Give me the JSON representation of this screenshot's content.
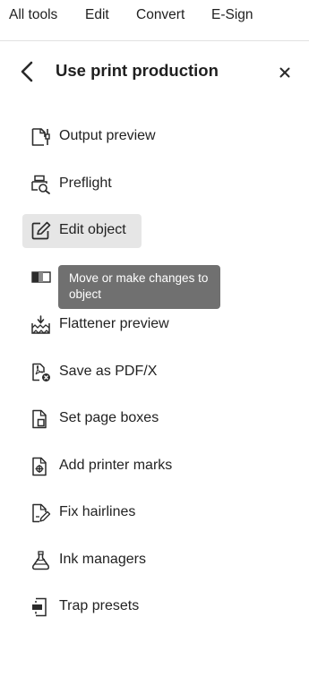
{
  "nav": {
    "items": [
      {
        "label": "All tools"
      },
      {
        "label": "Edit"
      },
      {
        "label": "Convert"
      },
      {
        "label": "E-Sign"
      }
    ]
  },
  "panel": {
    "title": "Use print production",
    "back_icon": "chevron-left-icon",
    "close_icon": "close-icon"
  },
  "tools": [
    {
      "label": "Output preview",
      "icon": "output-preview-icon"
    },
    {
      "label": "Preflight",
      "icon": "preflight-icon"
    },
    {
      "label": "Edit object",
      "icon": "edit-object-icon",
      "selected": true
    },
    {
      "label": "",
      "icon": "transparency-icon"
    },
    {
      "label": "Flattener preview",
      "icon": "flattener-preview-icon"
    },
    {
      "label": "Save as PDF/X",
      "icon": "save-pdfx-icon"
    },
    {
      "label": "Set page boxes",
      "icon": "set-page-boxes-icon"
    },
    {
      "label": "Add printer marks",
      "icon": "printer-marks-icon"
    },
    {
      "label": "Fix hairlines",
      "icon": "fix-hairlines-icon"
    },
    {
      "label": "Ink managers",
      "icon": "ink-manager-icon"
    },
    {
      "label": "Trap presets",
      "icon": "trap-presets-icon"
    }
  ],
  "tooltip": {
    "text": "Move or make changes to object"
  },
  "colors": {
    "selected_bg": "#e6e6e6",
    "tooltip_bg": "#707070",
    "text": "#222222"
  }
}
